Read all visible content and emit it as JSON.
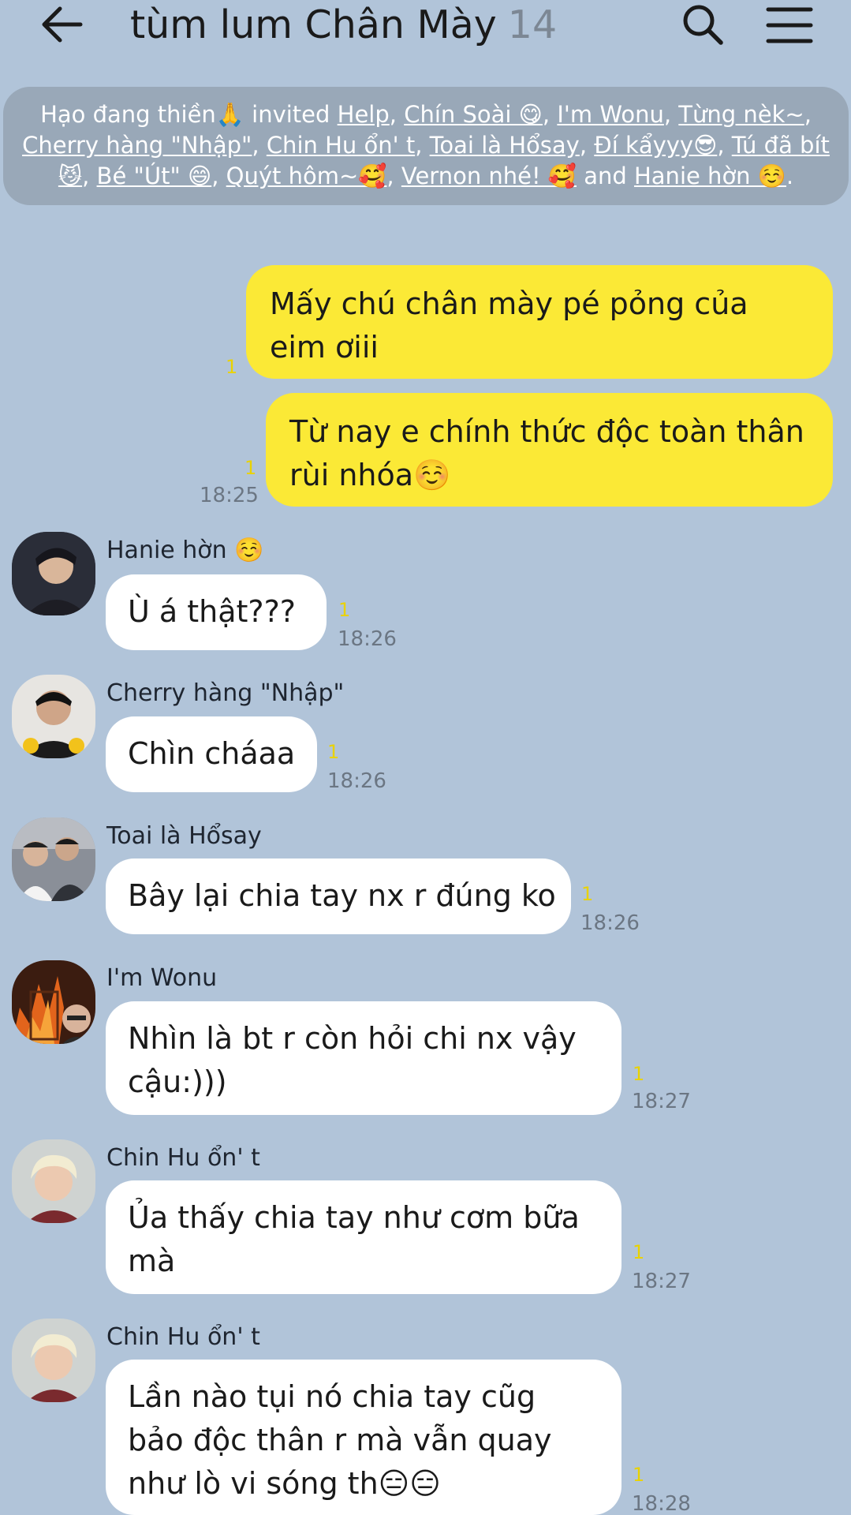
{
  "header": {
    "title": "tùm lum Chân Mày",
    "member_count": "14"
  },
  "notice": {
    "line1_a": "Hạo đang thiền🙏 invited ",
    "help": "Help",
    "chin_soai": "Chín Soài 😋",
    "im_wonu": "I'm Wonu",
    "tung_nek": "Từng nèk~",
    "cherry": "Cherry hàng \"Nhập\"",
    "chin_hu": "Chin Hu ổn' t",
    "toai": "Toai là Hổsay",
    "di_kayyy": "Đí kẩyyy😎",
    "tu_da_bit": "Tú đã bít😼",
    "be_ut": "Bé \"Út\" 😄",
    "quyt_hom": "Quýt hôm~🥰",
    "vernon": "Vernon nhé! 🥰",
    "and": " and ",
    "hanie": "Hanie hờn ☺️",
    "comma": ", ",
    "period": "."
  },
  "messages": {
    "out1": {
      "text": "Mấy chú chân mày pé pỏng của eim ơiii",
      "read": "1"
    },
    "out2": {
      "text": "Từ nay e chính thức độc toàn thân rùi nhóa☺️",
      "read": "1",
      "time": "18:25"
    },
    "in1": {
      "sender": "Hanie hờn ☺️",
      "text": "Ù á thật???",
      "read": "1",
      "time": "18:26"
    },
    "in2": {
      "sender": "Cherry hàng \"Nhập\"",
      "text": "Chìn cháaa",
      "read": "1",
      "time": "18:26"
    },
    "in3": {
      "sender": "Toai là Hổsay",
      "text": "Bây lại chia tay nx r đúng ko",
      "read": "1",
      "time": "18:26"
    },
    "in4": {
      "sender": "I'm Wonu",
      "text": "Nhìn là bt r còn hỏi chi nx vậy cậu:)))",
      "read": "1",
      "time": "18:27"
    },
    "in5": {
      "sender": "Chin Hu ổn' t",
      "text": "Ủa thấy chia tay như cơm bữa mà",
      "read": "1",
      "time": "18:27"
    },
    "in6": {
      "sender": "Chin Hu ổn' t",
      "text": "Lần nào tụi nó chia tay cũg bảo độc thân r mà vẫn quay như lò vi sóng th😑😑",
      "read": "1",
      "time": "18:28"
    }
  },
  "colors": {
    "background": "#b1c4d9",
    "outgoing_bubble": "#fbe936",
    "incoming_bubble": "#ffffff",
    "notice_bg": "#99a8b8",
    "read_count": "#e9d200"
  },
  "icons": [
    "back-arrow-icon",
    "search-icon",
    "menu-icon"
  ]
}
